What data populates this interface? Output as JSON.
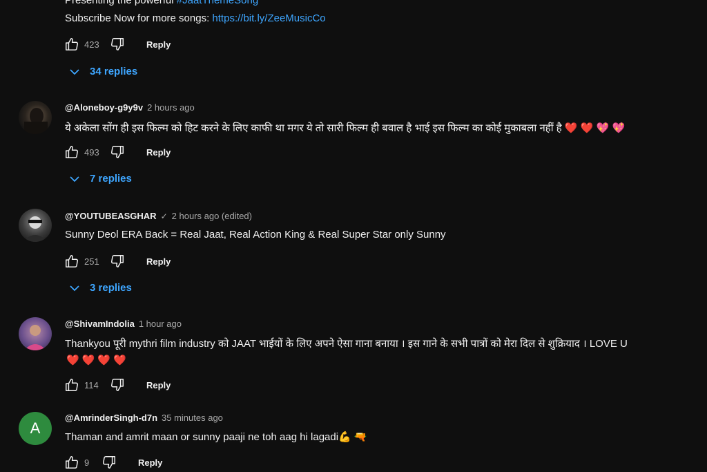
{
  "top_comment": {
    "line1_prefix": "Presenting the powerful ",
    "line1_hashtag": "#JaatThemeSong",
    "line2_prefix": "Subscribe Now for more songs: ",
    "line2_link": "https://bit.ly/ZeeMusicCo",
    "likes": "423",
    "reply_label": "Reply",
    "replies_label": "34 replies"
  },
  "comments": [
    {
      "handle": "@Aloneboy-g9y9v",
      "time": "2 hours ago",
      "text": "ये अकेला सोंग ही इस फिल्म को हिट करने के लिए काफी था मगर ये तो सारी फिल्म ही बवाल है भाई इस फिल्म का कोई मुकाबला नहीं है ❤️ ❤️ 💖 💖",
      "likes": "493",
      "reply_label": "Reply",
      "replies_label": "7 replies"
    },
    {
      "handle": "@YOUTUBEASGHAR",
      "verified_mark": "✓",
      "time": "2 hours ago (edited)",
      "text": "Sunny Deol ERA Back = Real Jaat, Real Action King & Real Super Star only Sunny",
      "likes": "251",
      "reply_label": "Reply",
      "replies_label": "3 replies"
    },
    {
      "handle": "@ShivamIndolia",
      "time": "1 hour ago",
      "text": "Thankyou पूरी mythri film industry को JAAT भाईयों के लिए अपने ऐसा गाना बनाया । इस गाने के सभी पात्रों को मेरा दिल से शुक्रियाद । LOVE U",
      "text_line2": "❤️❤️❤️❤️",
      "likes": "114",
      "reply_label": "Reply"
    },
    {
      "handle": "@AmrinderSingh-d7n",
      "time": "35 minutes ago",
      "avatar_letter": "A",
      "text": "Thaman and amrit maan or sunny paaji ne toh aag hi lagadi💪 🔫",
      "likes": "9",
      "reply_label": "Reply"
    }
  ],
  "colors": {
    "background": "#0f0f0f",
    "link": "#3ea6ff",
    "muted": "#aaaaaa",
    "avatar_green": "#2e8b3e"
  },
  "icons": [
    "like-icon",
    "dislike-icon",
    "chevron-down-icon",
    "verified-check-icon"
  ]
}
